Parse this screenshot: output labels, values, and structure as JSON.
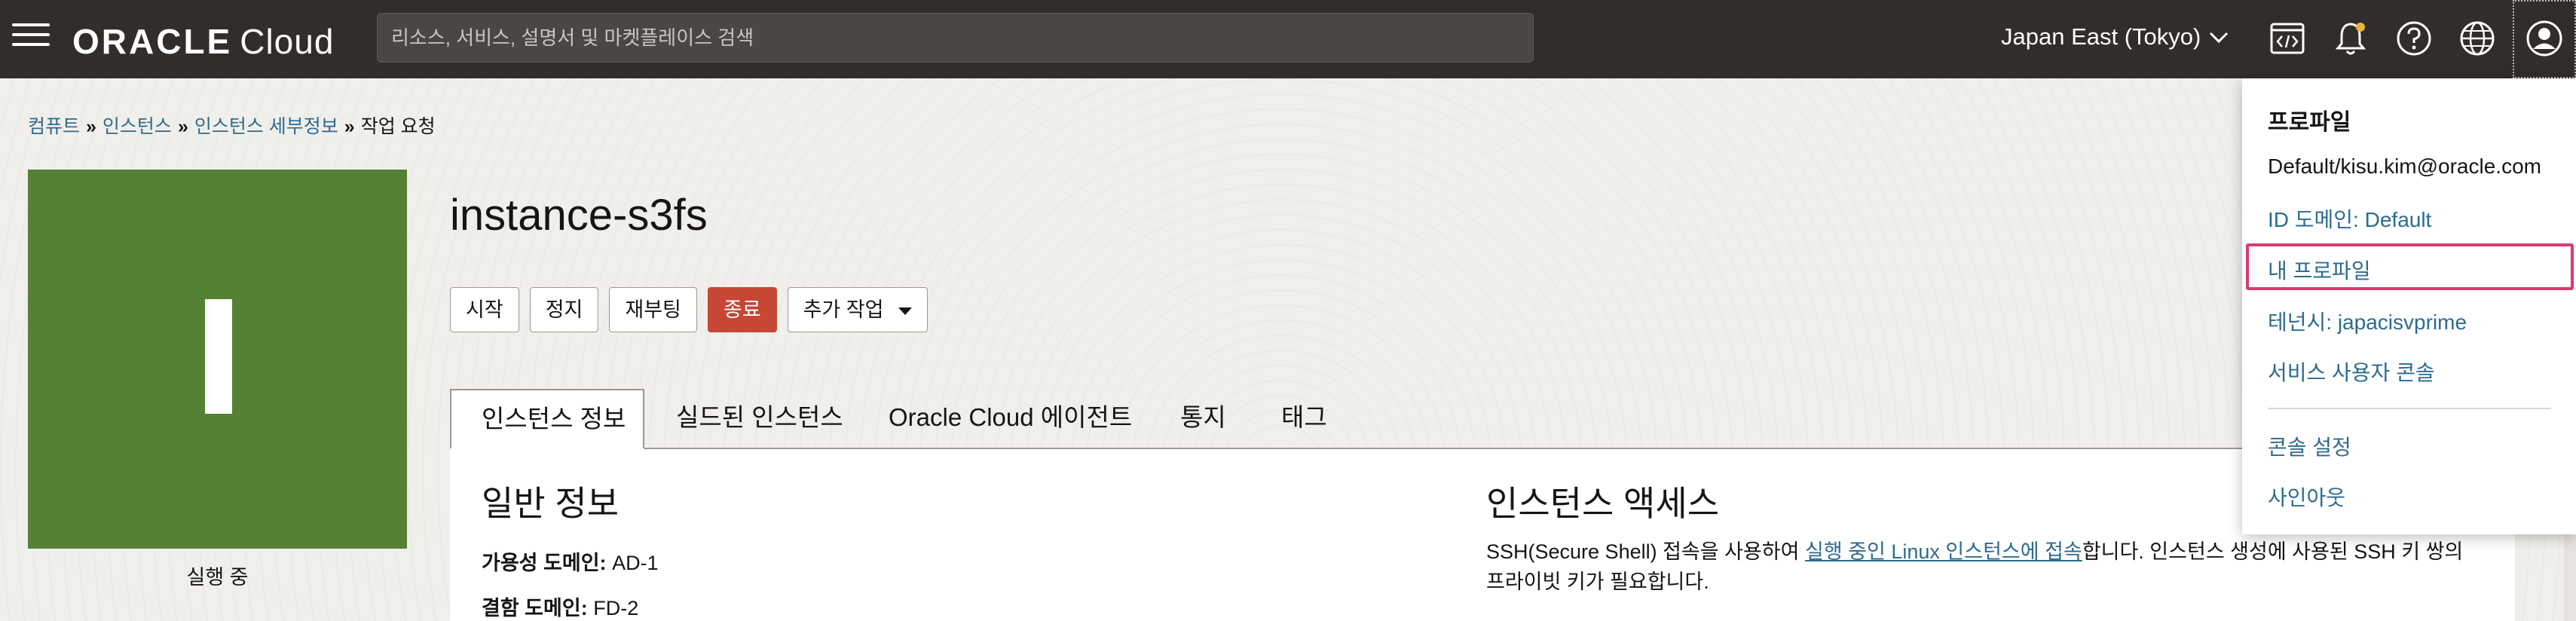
{
  "header": {
    "brand": "ORACLE",
    "product": "Cloud",
    "search_placeholder": "리소스, 서비스, 설명서 및 마켓플레이스 검색",
    "region": "Japan East (Tokyo)",
    "icons": [
      "menu-icon",
      "code-editor-icon",
      "notification-bell-icon",
      "help-icon",
      "language-globe-icon",
      "profile-icon"
    ]
  },
  "breadcrumb": {
    "items": [
      "컴퓨트",
      "인스턴스",
      "인스턴스 세부정보"
    ],
    "current": "작업 요청"
  },
  "instance": {
    "tile_letter": "I",
    "state": "실행 중",
    "name": "instance-s3fs",
    "tile_color": "#548134"
  },
  "actions": {
    "start": "시작",
    "stop": "정지",
    "reboot": "재부팅",
    "terminate": "종료",
    "more": "추가 작업"
  },
  "tabs": [
    "인스턴스 정보",
    "실드된 인스턴스",
    "Oracle Cloud 에이전트",
    "통지",
    "태그"
  ],
  "general": {
    "heading": "일반 정보",
    "availability_domain_label": "가용성 도메인:",
    "availability_domain": "AD-1",
    "fault_domain_label": "결함 도메인:",
    "fault_domain": "FD-2"
  },
  "access": {
    "heading": "인스턴스 액세스",
    "text_before": "SSH(Secure Shell) 접속을 사용하여 ",
    "link": "실행 중인 Linux 인스턴스에 접속",
    "text_after": "합니다. 인스턴스 생성에 사용된 SSH 키 쌍의 프라이빗 키가 필요합니다."
  },
  "profile_menu": {
    "title": "프로파일",
    "user": "Default/kisu.kim@oracle.com",
    "identity_domain": "ID 도메인: Default",
    "my_profile": "내 프로파일",
    "tenancy": "테넌시: japacisvprime",
    "service_user_console": "서비스 사용자 콘솔",
    "console_settings": "콘솔 설정",
    "sign_out": "사인아웃"
  },
  "colors": {
    "topbar": "#312d2a",
    "link": "#2d6b8e",
    "danger": "#c74634",
    "highlight": "#d63c6f"
  }
}
